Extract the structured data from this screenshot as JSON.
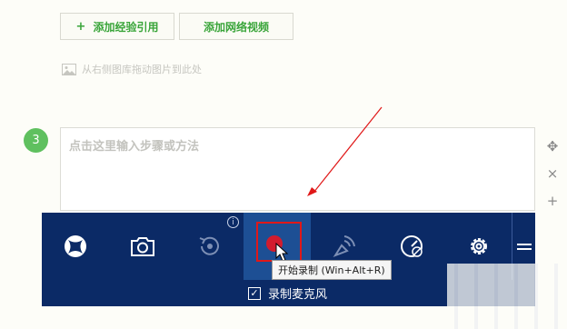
{
  "buttons": {
    "add_reference_plus": "+",
    "add_reference": "添加经验引用",
    "add_video": "添加网络视频"
  },
  "drag_hint": "从右侧图库拖动图片到此处",
  "step": {
    "number": "3",
    "placeholder": "点击这里输入步骤或方法"
  },
  "side_tools": {
    "move": "✥",
    "delete": "×",
    "add": "+"
  },
  "gamebar": {
    "info": "i",
    "tooltip": "开始录制 (Win+Alt+R)",
    "mic_checked": "✓",
    "mic_label": "录制麦克风",
    "bg_color": "#0b2a66",
    "active_color": "#1d4f94",
    "record_dot_color": "#d21c2e"
  },
  "annotation_color": "#e01818"
}
